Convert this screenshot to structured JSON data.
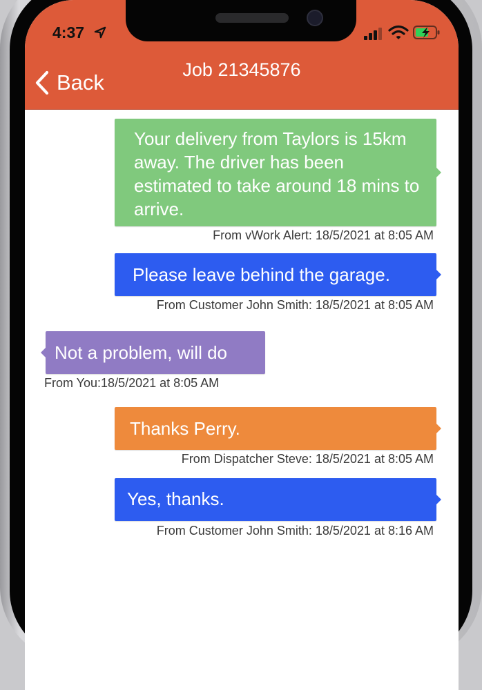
{
  "status_bar": {
    "time": "4:37",
    "icons": [
      "location-arrow-icon",
      "cellular-signal-icon",
      "wifi-icon",
      "battery-charging-icon"
    ]
  },
  "header": {
    "back_label": "Back",
    "title": "Job 21345876",
    "color": "#dd5a39"
  },
  "messages": [
    {
      "text": "Your delivery from Taylors is 15km away. The driver has been estimated to take around 18 mins to arrive.",
      "meta": "From vWork Alert: 18/5/2021 at 8:05 AM",
      "side": "right",
      "color": "#80c97d"
    },
    {
      "text": "Please leave behind the garage.",
      "meta": "From Customer John Smith: 18/5/2021 at 8:05 AM",
      "side": "right",
      "color": "#2d5cf0"
    },
    {
      "text": "Not a problem, will do",
      "meta": "From You:18/5/2021 at 8:05 AM",
      "side": "left",
      "color": "#907bc4"
    },
    {
      "text": "Thanks Perry.",
      "meta": "From Dispatcher Steve: 18/5/2021 at 8:05 AM",
      "side": "right",
      "color": "#ee8a3c"
    },
    {
      "text": "Yes, thanks.",
      "meta": "From Customer John Smith: 18/5/2021 at 8:16 AM",
      "side": "right",
      "color": "#2d5cf0"
    }
  ]
}
